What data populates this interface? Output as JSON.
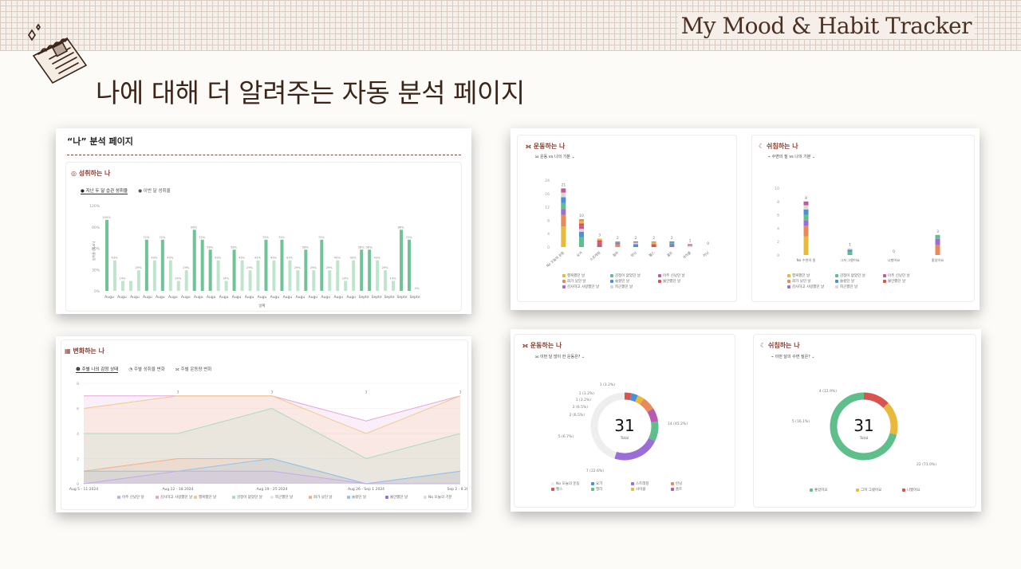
{
  "header": {
    "brand": "My Mood & Habit Tracker",
    "title": "나에 대해 더 알려주는 자동 분석 페이지"
  },
  "panel1": {
    "page_title": "“나” 분석 페이지",
    "section": "성취하는 나",
    "tabs": [
      "지난 두 달 습관 성취율",
      "이번 달 성취율"
    ],
    "chart_data": {
      "type": "bar",
      "ylabel": "성취율 (Sum)",
      "xlabel": "날짜",
      "ylim": [
        0,
        120
      ],
      "yticks": [
        "120%",
        "90%",
        "60%",
        "30%",
        "0%"
      ],
      "values": [
        100,
        43,
        14,
        14,
        29,
        72,
        43,
        72,
        43,
        14,
        29,
        86,
        72,
        58,
        43,
        14,
        58,
        43,
        29,
        43,
        72,
        43,
        72,
        43,
        29,
        58,
        29,
        72,
        29,
        43,
        14,
        43,
        58,
        58,
        43,
        29,
        14,
        86,
        72,
        0
      ],
      "value_labels": [
        "100%",
        "43%",
        "14%",
        "",
        "29%",
        "72%",
        "43%",
        "72%",
        "43%",
        "14%",
        "29%",
        "86%",
        "72%",
        "58%",
        "43%",
        "14%",
        "58%",
        "43%",
        "29%",
        "43%",
        "72%",
        "43%",
        "72%",
        "43%",
        "29%",
        "58%",
        "29%",
        "72%",
        "29%",
        "43%",
        "14%",
        "43%",
        "58%",
        "58%",
        "43%",
        "29%",
        "14%",
        "86%",
        "72%",
        "0%"
      ],
      "xticks": [
        "Augu",
        "Augu",
        "Augu",
        "Augu",
        "Augu",
        "Augu",
        "Augu",
        "Augu",
        "Augu",
        "Augu",
        "Augu",
        "Augu",
        "Augu",
        "Augu",
        "Augu",
        "Augu",
        "Augu",
        "Augu",
        "Augu",
        "Augu",
        "Septe",
        "Septe",
        "Septe",
        "Septe",
        "Septe"
      ]
    }
  },
  "panel2": {
    "card1": {
      "section": "운동하는 나",
      "subtitle": "운동 vs 나의 기분",
      "chart_data": {
        "type": "bar",
        "ylim": [
          0,
          24
        ],
        "yticks": [
          "24",
          "16",
          "12",
          "8",
          "4",
          "0"
        ],
        "categories": [
          "No 오늘의 운동",
          "요가",
          "스트레칭",
          "필라",
          "런닝",
          "헬스",
          "홈트",
          "사이클",
          "러닝"
        ],
        "totals": [
          21,
          10,
          3,
          2,
          2,
          2,
          2,
          1,
          0
        ],
        "legend": [
          "행복했던 날",
          "감정이 없었던 날",
          "아주 신났던 날",
          "화가 났던 날",
          "슬펐던 날",
          "불안했던 날",
          "감사하고 사랑했던 날",
          "피곤했던 날"
        ]
      }
    },
    "card2": {
      "section": "쉬침하는 나",
      "subtitle": "수면의 질 vs 나의 기분",
      "chart_data": {
        "type": "bar",
        "ylim": [
          0,
          10
        ],
        "yticks": [
          "10",
          "8",
          "6",
          "4",
          "2",
          "0"
        ],
        "categories": [
          "No 수면의 질",
          "그저 그랬어요",
          "나빴어요",
          "좋았어요"
        ],
        "totals": [
          8,
          1,
          0,
          3
        ],
        "legend": [
          "행복했던 날",
          "감정이 없었던 날",
          "아주 신났던 날",
          "화가 났던 날",
          "슬펐던 날",
          "불안했던 날",
          "감사하고 사랑했던 날",
          "피곤했던 날"
        ]
      }
    }
  },
  "panel3": {
    "section": "변화하는 나",
    "tabs": [
      "주별 나의 감정 상태",
      "주별 성취율 변화",
      "주별 운동량 변화"
    ],
    "chart_data": {
      "type": "area",
      "ylim": [
        0,
        8
      ],
      "yticks": [
        "8",
        "6",
        "4",
        "2",
        "0"
      ],
      "x": [
        "Aug 5 - 11 2024",
        "Aug 12 - 18 2024",
        "Aug 19 - 25 2024",
        "Aug 26 - Sep 1 2024",
        "Sep 2 - 8 2024"
      ],
      "top_labels": [
        "7",
        "7",
        "7",
        "7"
      ],
      "legend": [
        "아주 신났던 날",
        "감사하고 사랑했던 날",
        "행복했던 날",
        "감정이 없었던 날",
        "피곤했던 날",
        "화가 났던 날",
        "슬펐던 날",
        "불안했던 날",
        "No 오늘의 기분"
      ]
    }
  },
  "panel4": {
    "card1": {
      "section": "운동하는 나",
      "subtitle": "이번 달 많이 한 운동은?",
      "total": "31",
      "total_label": "Total",
      "chart_data": {
        "type": "pie",
        "labels": [
          "1 (3.2%)",
          "1 (3.2%)",
          "1 (3.2%)",
          "2 (6.5%)",
          "2 (6.5%)",
          "5 (6.7%)",
          "7 (22.6%)",
          "14 (45.2%)"
        ],
        "values": [
          1,
          1,
          1,
          2,
          2,
          3,
          7,
          14
        ]
      },
      "legend": [
        "No 오늘의 운동",
        "요가",
        "스트레칭",
        "런닝",
        "헬스",
        "필라",
        "사이클",
        "홈트"
      ]
    },
    "card2": {
      "section": "쉬침하는 나",
      "subtitle": "이번 달의 수면 질은?",
      "total": "31",
      "total_label": "Total",
      "chart_data": {
        "type": "pie",
        "labels": [
          "4 (12.9%)",
          "5 (16.1%)",
          "22 (71.0%)"
        ],
        "values": [
          4,
          5,
          22
        ]
      },
      "legend": [
        "좋았어요",
        "그저 그랬어요",
        "나빴어요"
      ]
    }
  },
  "colors": {
    "bar": "#6fc394",
    "bar_light": "#bfe5cc",
    "accent": "#8a3f33",
    "ink": "#3b2418"
  }
}
